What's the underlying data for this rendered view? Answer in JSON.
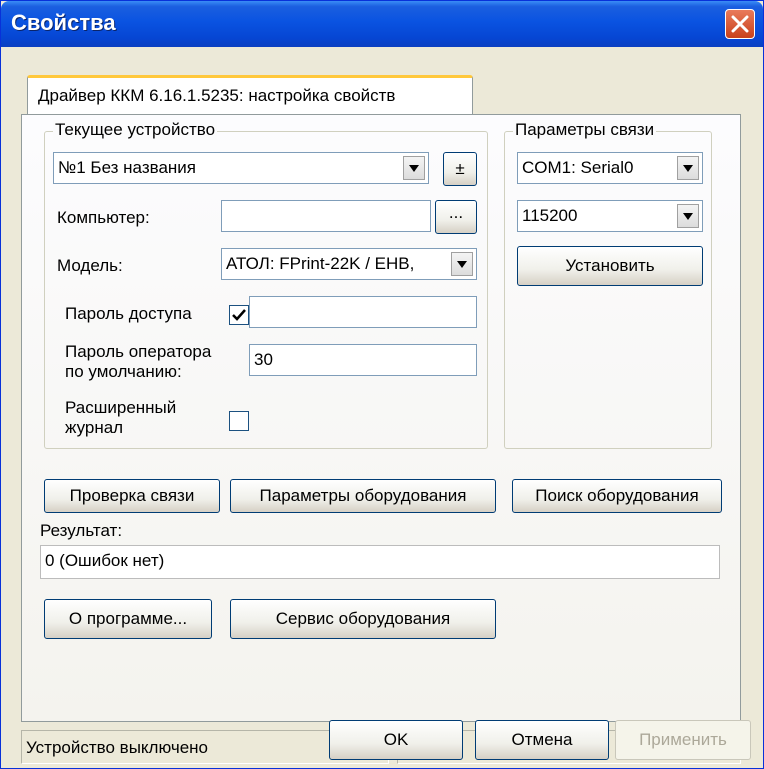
{
  "window": {
    "title": "Свойства"
  },
  "tab": {
    "label": "Драйвер ККМ 6.16.1.5235: настройка свойств"
  },
  "current_device": {
    "group_title": "Текущее устройство",
    "device_value": "№1 Без названия",
    "plusminus_label": "±",
    "computer_label": "Компьютер:",
    "computer_value": "",
    "browse_label": "...",
    "model_label": "Модель:",
    "model_value": "АТОЛ: FPrint-22K / ЕНВ,",
    "access_password_label": "Пароль доступа",
    "access_password_checked": true,
    "access_password_value": "",
    "operator_password_label_line1": "Пароль оператора",
    "operator_password_label_line2": "по умолчанию:",
    "operator_password_value": "30",
    "extended_log_label_line1": "Расширенный",
    "extended_log_label_line2": "журнал",
    "extended_log_checked": false
  },
  "connection": {
    "group_title": "Параметры связи",
    "port_value": "COM1: Serial0",
    "baud_value": "115200",
    "set_button": "Установить"
  },
  "actions": {
    "check_connection": "Проверка связи",
    "equipment_params": "Параметры оборудования",
    "equipment_search": "Поиск оборудования",
    "result_label": "Результат:",
    "result_value": "0 (Ошибок нет)",
    "about": "О программе...",
    "equipment_service": "Сервис оборудования"
  },
  "status": {
    "pane1": "Устройство выключено",
    "pane2": ""
  },
  "footer": {
    "ok": "OK",
    "cancel": "Отмена",
    "apply": "Применить"
  },
  "colors": {
    "titlebar": "#0a53e1",
    "dialog_bg": "#ece9d8",
    "close_button": "#c8411b"
  }
}
